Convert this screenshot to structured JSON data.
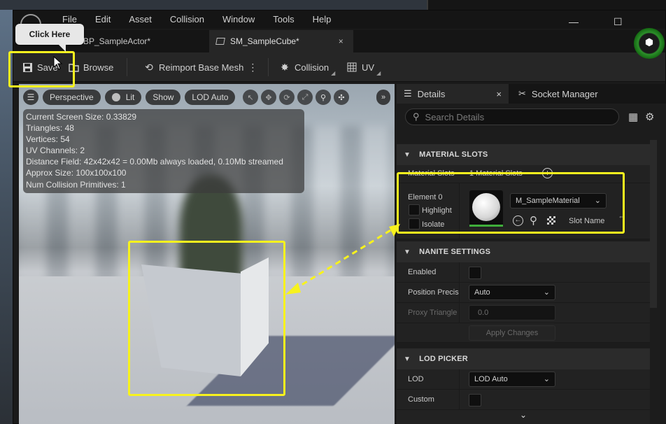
{
  "menu": [
    "File",
    "Edit",
    "Asset",
    "Collision",
    "Window",
    "Tools",
    "Help"
  ],
  "window_controls": [
    "—",
    "☐",
    "✕"
  ],
  "tabs": [
    {
      "label": "BP_SampleActor*"
    },
    {
      "label": "SM_SampleCube*",
      "close": "×"
    }
  ],
  "toolbar": {
    "save": "Save",
    "browse": "Browse",
    "reimport": "Reimport Base Mesh",
    "collision": "Collision",
    "uv": "UV"
  },
  "tooltip": "Click Here",
  "viewport": {
    "menu_icon": "☰",
    "perspective": "Perspective",
    "lit": "Lit",
    "show": "Show",
    "lod": "LOD Auto",
    "more": "»"
  },
  "stats": [
    "Current Screen Size: 0.33829",
    "Triangles: 48",
    "Vertices: 54",
    "UV Channels: 2",
    "Distance Field: 42x42x42 = 0.00Mb always loaded, 0.10Mb streamed",
    "Approx Size: 100x100x100",
    "Num Collision Primitives: 1"
  ],
  "details": {
    "tab": "Details",
    "tab_close": "×",
    "socket_tab": "Socket Manager",
    "search_placeholder": "Search Details",
    "material_slots_header": "MATERIAL SLOTS",
    "material_slots_label": "Material Slots",
    "material_slots_value": "1 Material Slots",
    "element_label": "Element 0",
    "highlight": "Highlight",
    "isolate": "Isolate",
    "material_name": "M_SampleMaterial",
    "slot_name": "Slot Name",
    "nanite_header": "NANITE SETTINGS",
    "enabled": "Enabled",
    "position_precision": "Position Precis",
    "position_precision_value": "Auto",
    "proxy_triangle": "Proxy Triangle",
    "proxy_value": "0.0",
    "apply_changes": "Apply Changes",
    "lod_picker_header": "LOD PICKER",
    "lod_label": "LOD",
    "lod_value": "LOD Auto",
    "custom_label": "Custom"
  }
}
